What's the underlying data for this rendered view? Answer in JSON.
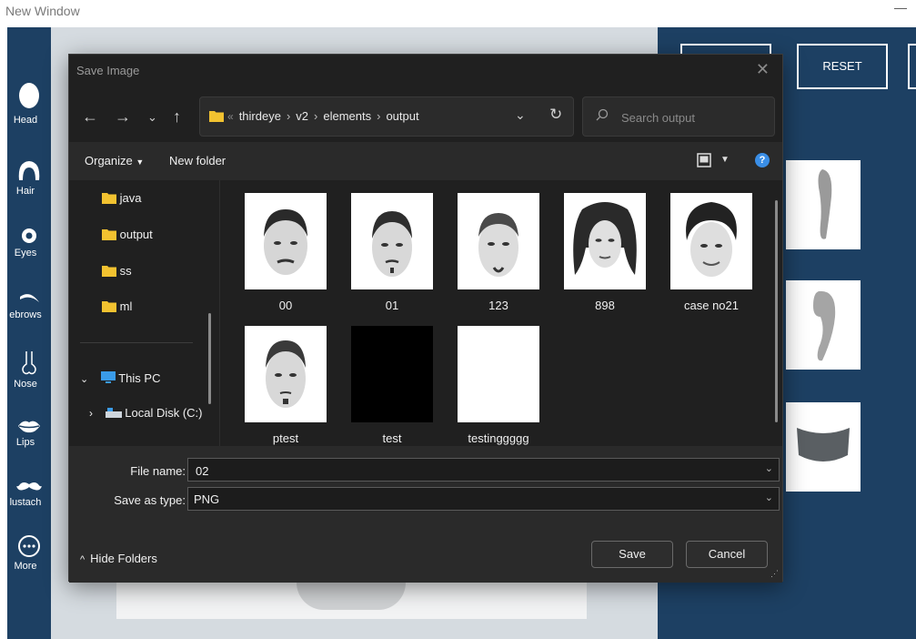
{
  "app": {
    "title": "New Window",
    "sidebar": [
      {
        "label": "Head",
        "icon": "head-icon"
      },
      {
        "label": "Hair",
        "icon": "hair-icon"
      },
      {
        "label": "Eyes",
        "icon": "eye-icon"
      },
      {
        "label": "ebrows",
        "icon": "eyebrow-icon"
      },
      {
        "label": "Nose",
        "icon": "nose-icon"
      },
      {
        "label": "Lips",
        "icon": "lips-icon"
      },
      {
        "label": "lustach",
        "icon": "mustache-icon"
      },
      {
        "label": "More",
        "icon": "more-icon"
      }
    ],
    "right_buttons": {
      "reset": "RESET"
    },
    "colors": {
      "panel": "#1d4063",
      "dialog": "#202020",
      "accent": "#3a8ee6"
    }
  },
  "dialog": {
    "title": "Save Image",
    "breadcrumb": [
      "thirdeye",
      "v2",
      "elements",
      "output"
    ],
    "search_placeholder": "Search output",
    "toolbar": {
      "organize": "Organize",
      "new_folder": "New folder",
      "help": "?"
    },
    "nav": {
      "folders": [
        "java",
        "output",
        "ss",
        "ml"
      ],
      "this_pc": "This PC",
      "local_disk": "Local Disk (C:)"
    },
    "files": [
      {
        "name": "00",
        "kind": "face"
      },
      {
        "name": "01",
        "kind": "face"
      },
      {
        "name": "123",
        "kind": "face"
      },
      {
        "name": "898",
        "kind": "face"
      },
      {
        "name": "case no21",
        "kind": "face"
      },
      {
        "name": "ptest",
        "kind": "face"
      },
      {
        "name": "test",
        "kind": "black"
      },
      {
        "name": "testinggggg",
        "kind": "white"
      }
    ],
    "file_name_label": "File name:",
    "file_name_value": "02",
    "save_type_label": "Save as type:",
    "save_type_value": "PNG",
    "hide_folders": "Hide Folders",
    "save": "Save",
    "cancel": "Cancel"
  }
}
